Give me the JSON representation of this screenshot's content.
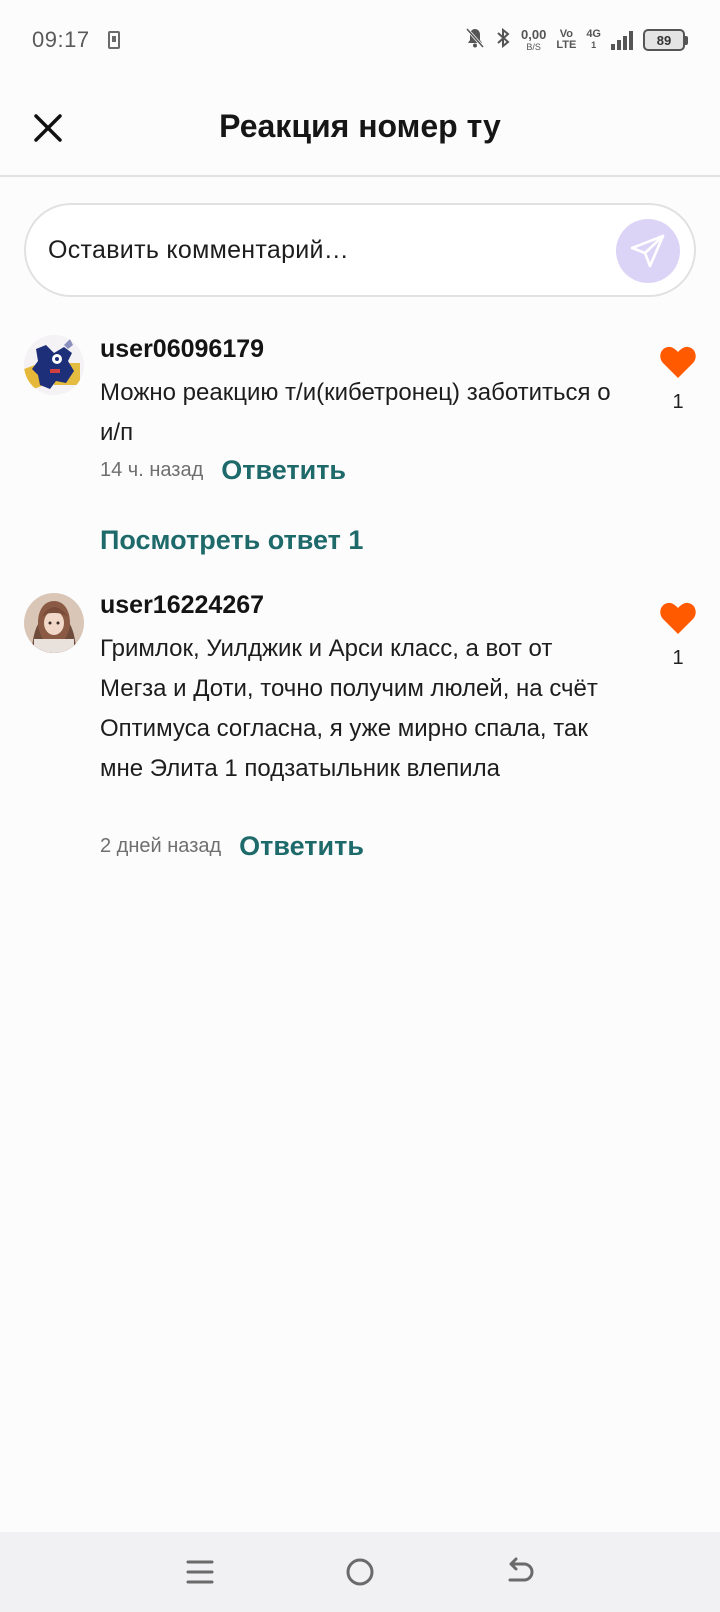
{
  "status_bar": {
    "time": "09:17",
    "net_speed_value": "0,00",
    "net_speed_unit": "B/S",
    "volte_top": "Vo",
    "volte_bottom": "LTE",
    "network_top": "4G",
    "network_bottom": "1",
    "battery": "89"
  },
  "header": {
    "title": "Реакция номер ту"
  },
  "comment_input": {
    "placeholder": "Оставить комментарий…"
  },
  "colors": {
    "accent_teal": "#1e6a6a",
    "like_orange": "#ff5a00",
    "send_bg": "#dcd4f6"
  },
  "comments": [
    {
      "username": "user06096179",
      "text": "Можно реакцию т/и(кибетронец) заботиться о и/п",
      "time": "14 ч. назад",
      "reply_label": "Ответить",
      "likes": "1",
      "view_replies": "Посмотреть ответ 1"
    },
    {
      "username": "user16224267",
      "text": "Гримлок, Уилджик и Арси класс, а вот от Мегза и Доти, точно получим люлей, на счёт Оптимуса согласна, я уже мирно спала, так мне Элита 1 подзатыльник влепила",
      "time": "2 дней назад",
      "reply_label": "Ответить",
      "likes": "1"
    }
  ],
  "nav_bar": {
    "icons": [
      "menu-icon",
      "home-icon",
      "back-icon"
    ]
  }
}
